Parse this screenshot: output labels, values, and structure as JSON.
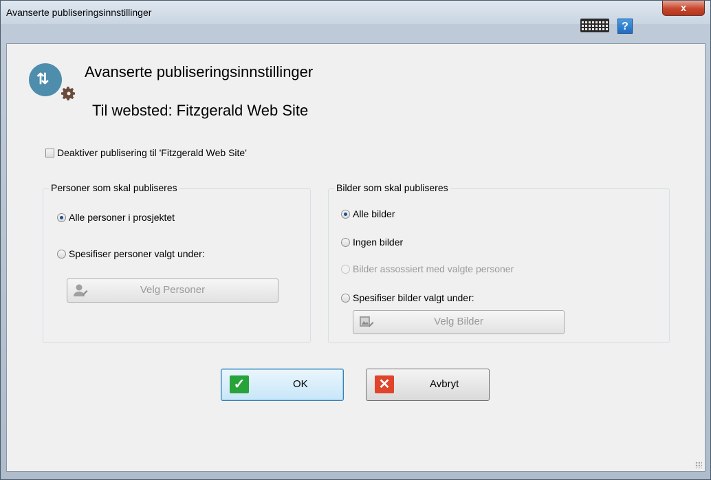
{
  "window": {
    "title": "Avanserte publiseringsinnstillinger",
    "close_label": "x",
    "help_label": "?"
  },
  "header": {
    "title": "Avanserte publiseringsinnstillinger",
    "subtitle": "Til websted: Fitzgerald Web Site"
  },
  "disable_checkbox": {
    "label": "Deaktiver publisering til 'Fitzgerald Web Site'",
    "checked": false
  },
  "persons_group": {
    "title": "Personer som skal publiseres",
    "options": [
      {
        "label": "Alle personer i prosjektet",
        "checked": true,
        "enabled": true
      },
      {
        "label": "Spesifiser personer valgt under:",
        "checked": false,
        "enabled": true
      }
    ],
    "select_button": "Velg Personer"
  },
  "images_group": {
    "title": "Bilder som skal publiseres",
    "options": [
      {
        "label": "Alle bilder",
        "checked": true,
        "enabled": true
      },
      {
        "label": "Ingen bilder",
        "checked": false,
        "enabled": true
      },
      {
        "label": "Bilder assossiert med valgte personer",
        "checked": false,
        "enabled": false
      },
      {
        "label": "Spesifiser bilder valgt under:",
        "checked": false,
        "enabled": true
      }
    ],
    "select_button": "Velg Bilder"
  },
  "buttons": {
    "ok": "OK",
    "cancel": "Avbryt",
    "ok_color": "#27a33a",
    "cancel_color": "#e0442a"
  },
  "icons": {
    "app": "publish-settings-icon",
    "keyboard": "keyboard-icon",
    "help": "help-icon",
    "close": "close-icon"
  }
}
